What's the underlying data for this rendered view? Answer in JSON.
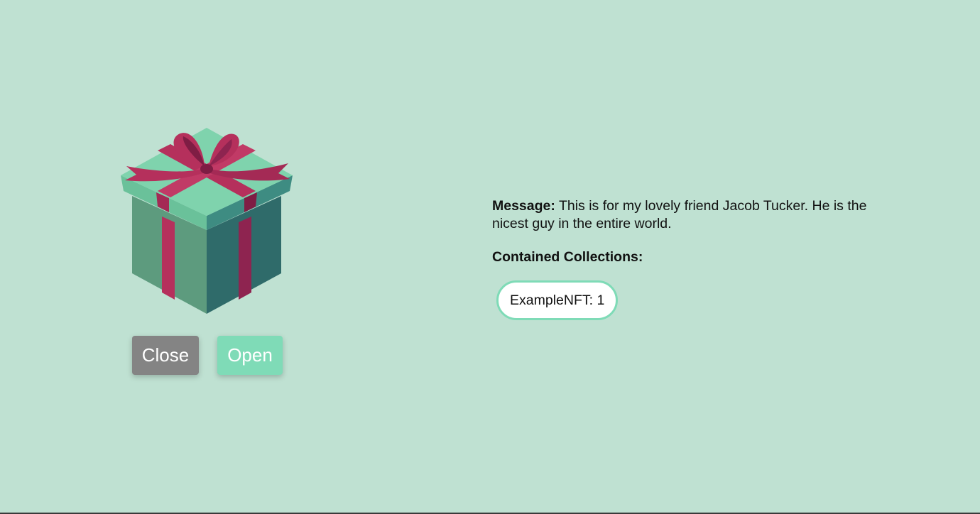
{
  "gift": {
    "icon": "gift-box-icon",
    "colors": {
      "box_left": "#5d9b7e",
      "box_right": "#2f6b6a",
      "lid_top": "#7fd3ad",
      "lid_left": "#6ac19a",
      "lid_right": "#3e8c82",
      "ribbon": "#b5305c",
      "ribbon_dark": "#7f1d44"
    }
  },
  "actions": {
    "close_label": "Close",
    "open_label": "Open"
  },
  "details": {
    "message_label": "Message:",
    "message_text": "This is for my lovely friend Jacob Tucker. He is the nicest guy in the entire world.",
    "collections_heading": "Contained Collections:",
    "collections": [
      {
        "name": "ExampleNFT",
        "count": 1,
        "display": "ExampleNFT: 1"
      }
    ]
  },
  "theme": {
    "background": "#bfe1d2",
    "accent": "#7fdbb7",
    "neutral_button": "#848484"
  }
}
